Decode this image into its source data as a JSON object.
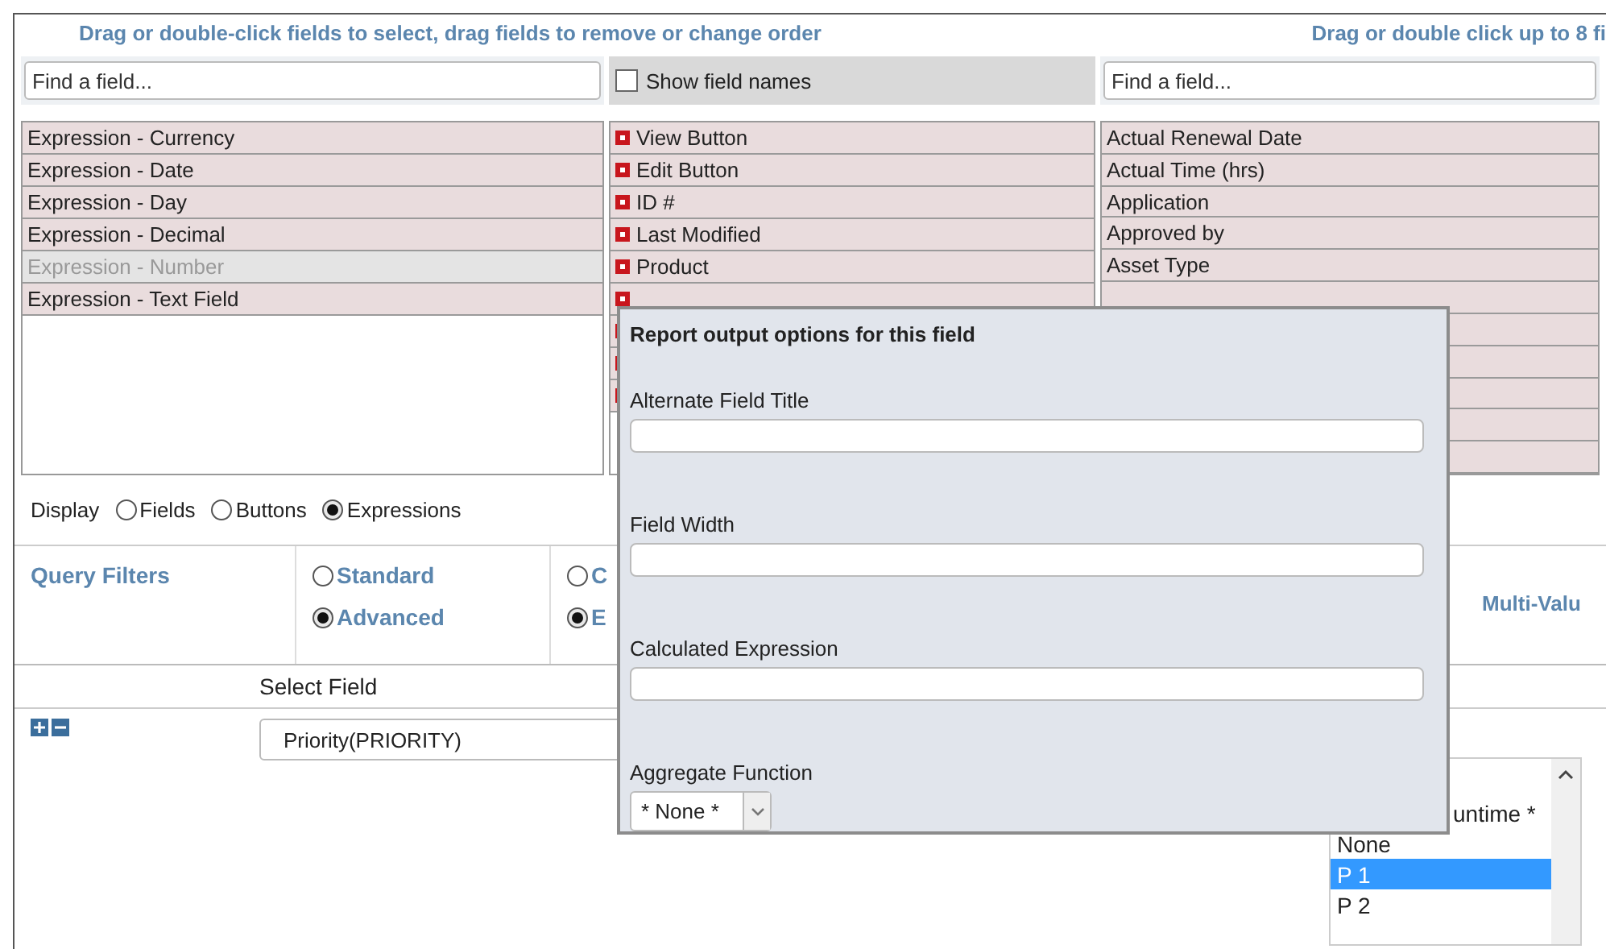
{
  "header": {
    "left_hint": "Drag or double-click fields to select, drag fields to remove or change order",
    "right_hint": "Drag or double click up to 8 fi"
  },
  "available": {
    "search": {
      "placeholder": "Find a field..."
    },
    "items": [
      {
        "label": "Expression - Currency",
        "disabled": false
      },
      {
        "label": "Expression - Date",
        "disabled": false
      },
      {
        "label": "Expression - Day",
        "disabled": false
      },
      {
        "label": "Expression - Decimal",
        "disabled": false
      },
      {
        "label": "Expression - Number",
        "disabled": true
      },
      {
        "label": "Expression - Text Field",
        "disabled": false
      }
    ]
  },
  "show_field_names": {
    "label": "Show field names",
    "checked": false
  },
  "selected_fields": {
    "items": [
      "View Button",
      "Edit Button",
      "ID #",
      "Last Modified",
      "Product"
    ]
  },
  "right_panel": {
    "search": {
      "placeholder": "Find a field..."
    },
    "items": [
      "Actual Renewal Date",
      "Actual Time (hrs)",
      "Application",
      "Approved by",
      "Asset Type"
    ]
  },
  "display": {
    "label": "Display",
    "options": [
      {
        "label": "Fields",
        "selected": false
      },
      {
        "label": "Buttons",
        "selected": false
      },
      {
        "label": "Expressions",
        "selected": true
      }
    ]
  },
  "query_filters": {
    "title": "Query Filters",
    "mode_options": [
      {
        "label": "Standard",
        "selected": false
      },
      {
        "label": "Advanced",
        "selected": true
      }
    ],
    "logic_options": [
      {
        "label": "C",
        "selected": false
      },
      {
        "label": "E",
        "selected": true
      }
    ],
    "multi_value_label": "Multi-Valu"
  },
  "filter_table": {
    "columns": [
      "Select Field"
    ],
    "rows": [
      {
        "field": "Priority(PRIORITY)"
      }
    ]
  },
  "value_list": {
    "items": [
      {
        "label": "untime *",
        "selected": false
      },
      {
        "label": "None",
        "selected": false
      },
      {
        "label": "P 1",
        "selected": true
      },
      {
        "label": "P 2",
        "selected": false
      }
    ]
  },
  "popup": {
    "title": "Report output options for this field",
    "fields": [
      {
        "label": "Alternate Field Title",
        "kind": "text"
      },
      {
        "label": "Field Width",
        "kind": "text"
      },
      {
        "label": "Calculated Expression",
        "kind": "text"
      },
      {
        "label": "Aggregate Function",
        "kind": "select",
        "value": "* None *"
      }
    ]
  }
}
